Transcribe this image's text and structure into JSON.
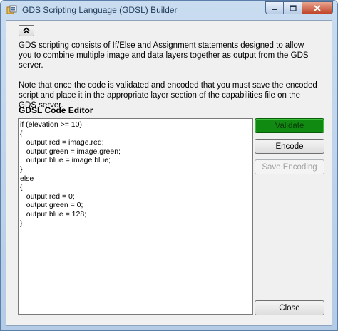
{
  "window": {
    "title": "GDS Scripting Language (GDSL) Builder",
    "icons": {
      "app": "app-icon",
      "minimize": "minimize-icon",
      "maximize": "maximize-icon",
      "close": "close-icon"
    }
  },
  "info": {
    "collapse_icon": "double-chevron-up-icon",
    "paragraph1": "GDS scripting consists of If/Else and Assignment statements designed to allow you to combine multiple image and data layers together as output from the GDS server.",
    "paragraph2": "Note that once the code is validated and encoded that you must save the encoded script and place it in the appropriate layer section of the capabilities file on the GDS server."
  },
  "editor": {
    "label": "GDSL Code Editor",
    "code": "if (elevation >= 10)\n{\n   output.red = image.red;\n   output.green = image.green;\n   output.blue = image.blue;\n}\nelse\n{\n   output.red = 0;\n   output.green = 0;\n   output.blue = 128;\n}"
  },
  "buttons": {
    "validate": "Validate",
    "encode": "Encode",
    "save_encoding": "Save Encoding",
    "close": "Close"
  },
  "colors": {
    "validate_bg": "#108a10",
    "close_caption": "#c0452a"
  }
}
